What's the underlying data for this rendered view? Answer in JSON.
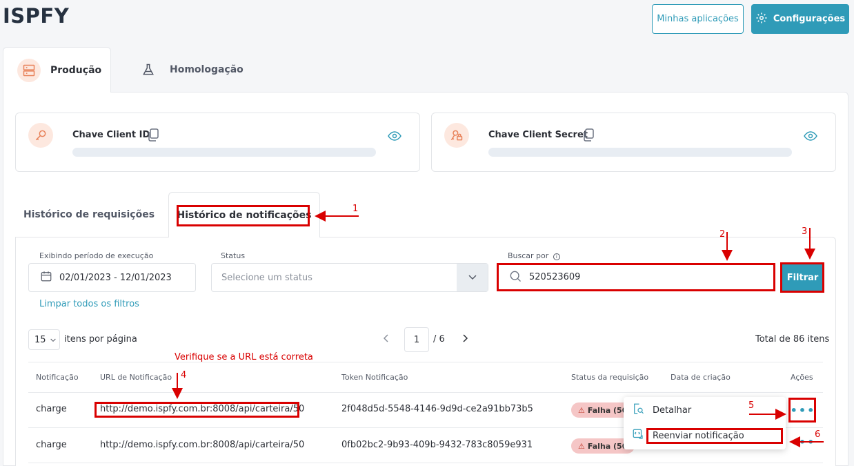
{
  "brand": "ISPFY",
  "header": {
    "my_apps": "Minhas aplicações",
    "settings": "Configurações"
  },
  "env_tabs": [
    {
      "label": "Produção",
      "icon": "server-icon",
      "active": true
    },
    {
      "label": "Homologação",
      "icon": "flask-icon",
      "active": false
    }
  ],
  "keys": [
    {
      "title": "Chave Client ID",
      "icon": "key-icon"
    },
    {
      "title": "Chave Client Secret",
      "icon": "lock-key-icon"
    }
  ],
  "history_tabs": [
    {
      "label": "Histórico de requisições",
      "active": false
    },
    {
      "label": "Histórico de notificações",
      "active": true
    }
  ],
  "filters": {
    "period_label": "Exibindo período de execução",
    "period_value": "02/01/2023 - 12/01/2023",
    "status_label": "Status",
    "status_placeholder": "Selecione um status",
    "search_label": "Buscar por",
    "search_value": "520523609",
    "filter_button": "Filtrar",
    "clear_filters": "Limpar todos os filtros"
  },
  "pagination": {
    "per_page": "15",
    "per_page_label": "itens por página",
    "current_page": "1",
    "total_pages": "/ 6",
    "total_label": "Total de 86 itens"
  },
  "table": {
    "headers": [
      "Notificação",
      "URL de Notificação",
      "Token Notificação",
      "Status da requisição",
      "Data de criação",
      "Ações"
    ],
    "rows": [
      {
        "type": "charge",
        "url": "http://demo.ispfy.com.br:8008/api/carteira/50",
        "token": "2f048d5d-5548-4146-9d9d-ce2a91bb73b5",
        "status": "Falha (50"
      },
      {
        "type": "charge",
        "url": "http://demo.ispfy.com.br:8008/api/carteira/50",
        "token": "0fb02bc2-9b93-409b-9432-783c8059e931",
        "status": "Falha (50"
      }
    ]
  },
  "menu": {
    "detail": "Detalhar",
    "resend": "Reenviar notificação"
  },
  "annotations": {
    "n1": "1",
    "n2": "2",
    "n3": "3",
    "n4": "4",
    "n5": "5",
    "n6": "6",
    "url_note": "Verifique se a URL está correta"
  },
  "colors": {
    "accent": "#2f9bb8",
    "annotation": "#d90000",
    "icon_bg": "#fde8df",
    "fail_badge": "#f5c6c6"
  }
}
